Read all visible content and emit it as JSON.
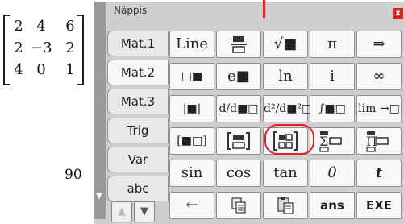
{
  "workspace": {
    "matrix": [
      [
        "2",
        "4",
        "6"
      ],
      [
        "2",
        "−3",
        "2"
      ],
      [
        "4",
        "0",
        "1"
      ]
    ],
    "result": "90"
  },
  "keypad": {
    "title": "Näppis",
    "close_label": "x",
    "tabs": [
      {
        "label": "Mat.1"
      },
      {
        "label": "Mat.2",
        "active": true
      },
      {
        "label": "Mat.3"
      },
      {
        "label": "Trig"
      },
      {
        "label": "Var"
      },
      {
        "label": "abc"
      }
    ],
    "scroll_up": "▲",
    "scroll_down": "▼",
    "keys": {
      "row1": [
        "Line",
        "fraction-bar-icon",
        "√■",
        "π",
        "⇒"
      ],
      "row2": [
        "□■",
        "e■",
        "ln",
        "i",
        "∞"
      ],
      "row3": [
        "|■|",
        "d/d■□",
        "d²/d■²□",
        "∫■□",
        "lim →□"
      ],
      "row4": [
        "[■□]",
        "matrix-2row-icon",
        "matrix-2x2-icon",
        "sum-icon",
        "product-icon"
      ],
      "row5": [
        "sin",
        "cos",
        "tan",
        "θ",
        "t"
      ],
      "row6": [
        "←",
        "copy-icon",
        "paste-icon",
        "ans",
        "EXE"
      ]
    },
    "annotation_colors": {
      "red": "#e31e24"
    }
  }
}
